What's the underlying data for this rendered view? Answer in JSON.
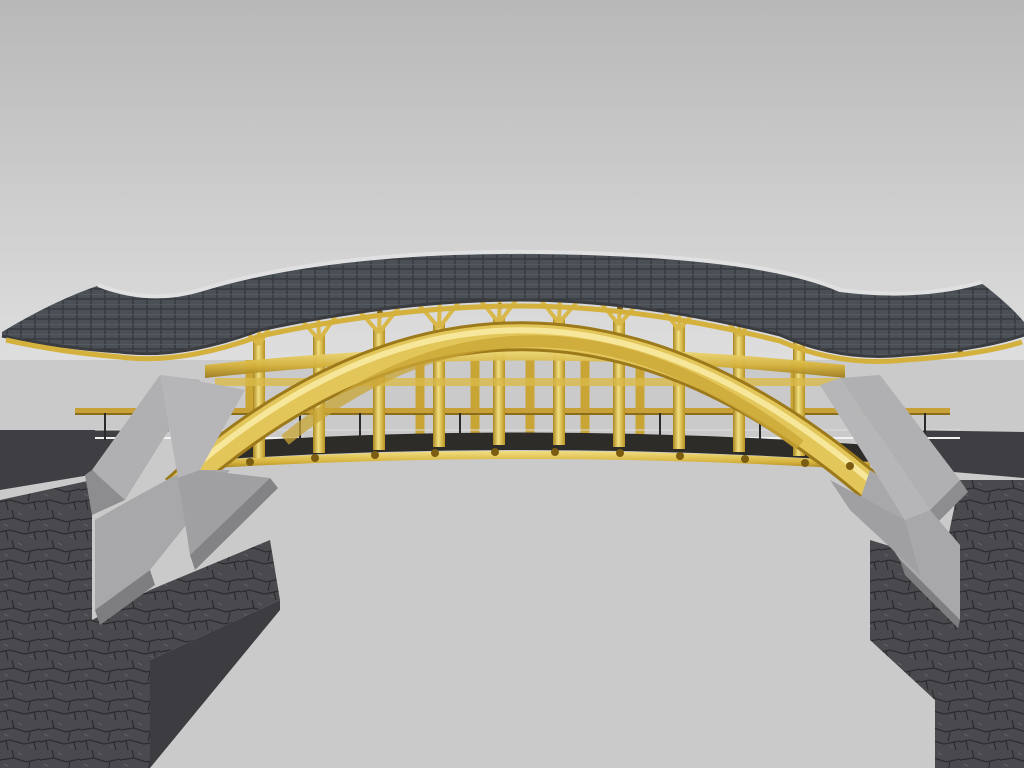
{
  "scene": {},
  "colors": {
    "sky_top": "#b9b9b9",
    "sky_bottom": "#dcdcdc",
    "ground": "#c9c9c9",
    "roof_tiles": "#4a4f55",
    "roof_edge": "#d8d8d8",
    "bamboo": "#d4b13c",
    "bamboo_light": "#f0dc7a",
    "bamboo_dark": "#9c7a1c",
    "stone": "#4b4b4f",
    "concrete": "#a9a9ab"
  }
}
